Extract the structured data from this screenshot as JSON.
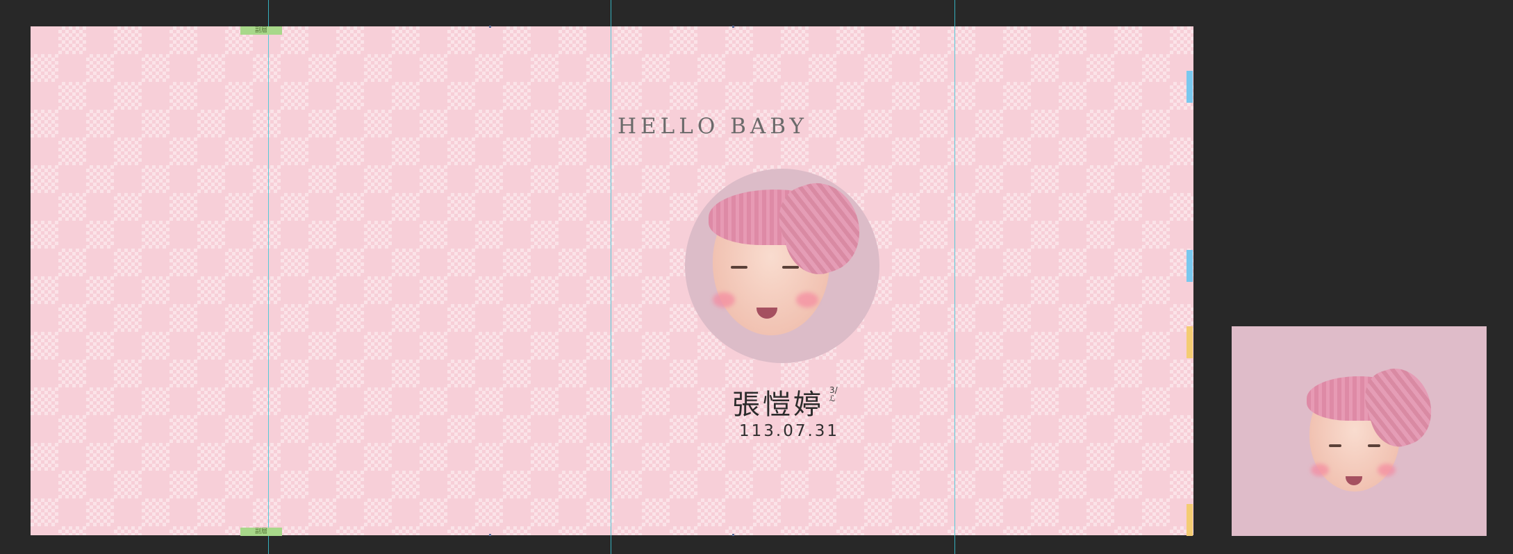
{
  "canvas": {
    "title": "HELLO BABY",
    "name": "張愷婷",
    "name_mark": "3/ℒ",
    "date": "113.07.31",
    "tags": {
      "top_left": "副層",
      "bottom_left": "副層"
    }
  },
  "colors": {
    "workspace_bg": "#282828",
    "artboard_pink": "#f7cfd8",
    "guide_cyan": "#38c8d8",
    "thumb_bg": "#dfbcc9"
  },
  "icons": {
    "main_photo": "baby-face-icon",
    "thumb_photo": "baby-face-icon"
  }
}
